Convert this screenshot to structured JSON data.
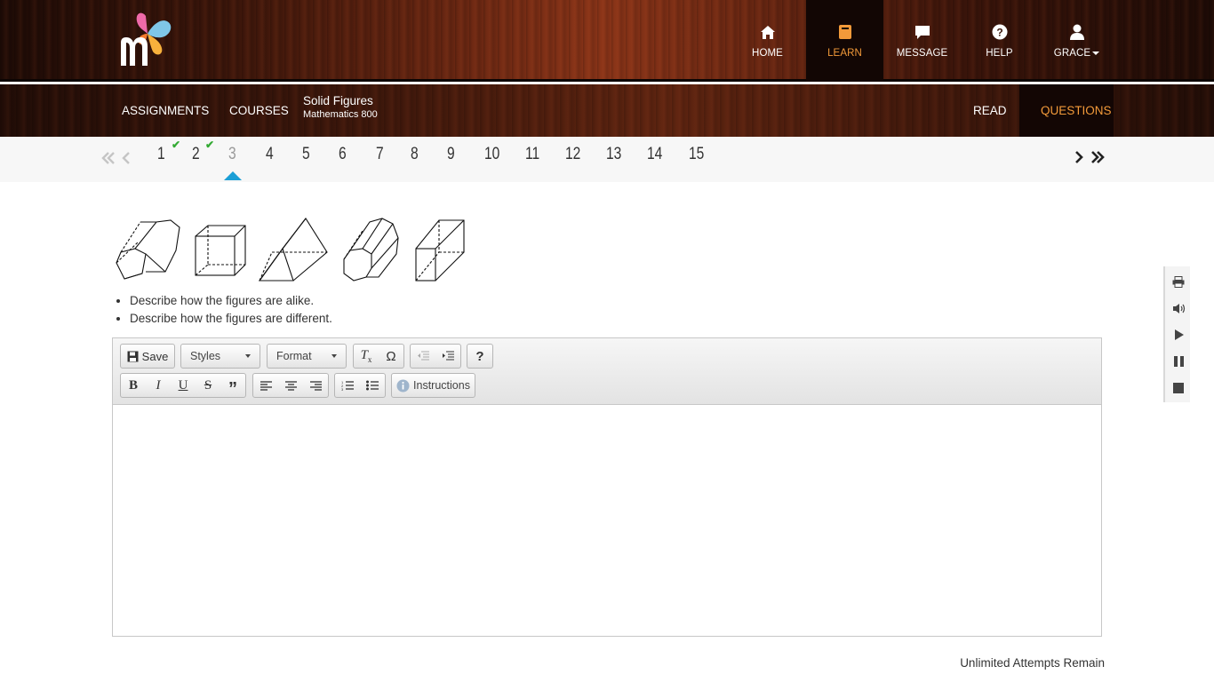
{
  "header": {
    "nav": [
      {
        "label": "HOME",
        "icon": "home-icon"
      },
      {
        "label": "LEARN",
        "icon": "book-icon",
        "active": true
      },
      {
        "label": "MESSAGE",
        "icon": "message-icon"
      },
      {
        "label": "HELP",
        "icon": "help-icon"
      },
      {
        "label": "GRACE",
        "icon": "user-icon",
        "dropdown": true
      }
    ],
    "accent_color": "#f39a3a"
  },
  "subnav": {
    "assignments": "ASSIGNMENTS",
    "courses": "COURSES",
    "lesson_title": "Solid Figures",
    "course_name": "Mathematics 800",
    "read": "READ",
    "questions": "QUESTIONS"
  },
  "pager": {
    "numbers": [
      "1",
      "2",
      "3",
      "4",
      "5",
      "6",
      "7",
      "8",
      "9",
      "10",
      "11",
      "12",
      "13",
      "14",
      "15"
    ],
    "completed": [
      "1",
      "2"
    ],
    "current": "3"
  },
  "question": {
    "bullets": [
      "Describe how the figures are alike.",
      "Describe how the figures are different."
    ]
  },
  "editor": {
    "save_label": "Save",
    "styles_label": "Styles",
    "format_label": "Format",
    "instructions_label": "Instructions",
    "help_label": "?"
  },
  "footer": {
    "attempts": "Unlimited Attempts Remain"
  }
}
